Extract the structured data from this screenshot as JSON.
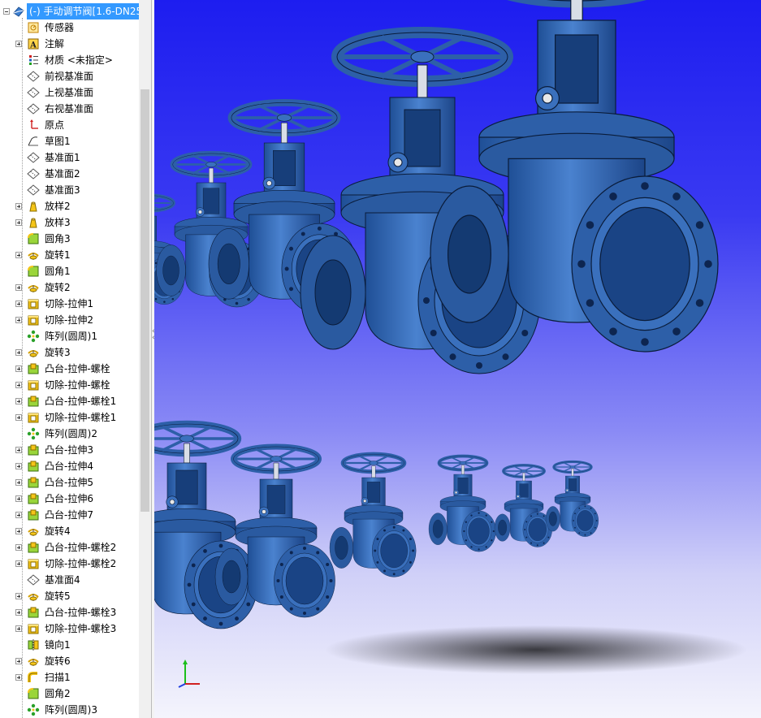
{
  "feature_tree": {
    "root_label": "(-) 手动调节阀[1.6-DN25",
    "items": [
      {
        "label": "传感器",
        "icon": "sensor-icon",
        "expandable": false
      },
      {
        "label": "注解",
        "icon": "annotation-icon",
        "expandable": true
      },
      {
        "label": "材质 <未指定>",
        "icon": "material-icon",
        "expandable": false
      },
      {
        "label": "前视基准面",
        "icon": "plane-icon",
        "expandable": false
      },
      {
        "label": "上视基准面",
        "icon": "plane-icon",
        "expandable": false
      },
      {
        "label": "右视基准面",
        "icon": "plane-icon",
        "expandable": false
      },
      {
        "label": "原点",
        "icon": "origin-icon",
        "expandable": false
      },
      {
        "label": "草图1",
        "icon": "sketch-icon",
        "expandable": false
      },
      {
        "label": "基准面1",
        "icon": "plane-icon",
        "expandable": false
      },
      {
        "label": "基准面2",
        "icon": "plane-icon",
        "expandable": false
      },
      {
        "label": "基准面3",
        "icon": "plane-icon",
        "expandable": false
      },
      {
        "label": "放样2",
        "icon": "loft-icon",
        "expandable": true
      },
      {
        "label": "放样3",
        "icon": "loft-icon",
        "expandable": true
      },
      {
        "label": "圆角3",
        "icon": "fillet-icon",
        "expandable": false
      },
      {
        "label": "旋转1",
        "icon": "revolve-icon",
        "expandable": true
      },
      {
        "label": "圆角1",
        "icon": "fillet-icon",
        "expandable": false
      },
      {
        "label": "旋转2",
        "icon": "revolve-icon",
        "expandable": true
      },
      {
        "label": "切除-拉伸1",
        "icon": "cut-extrude-icon",
        "expandable": true
      },
      {
        "label": "切除-拉伸2",
        "icon": "cut-extrude-icon",
        "expandable": true
      },
      {
        "label": "阵列(圆周)1",
        "icon": "circular-pattern-icon",
        "expandable": false
      },
      {
        "label": "旋转3",
        "icon": "revolve-icon",
        "expandable": true
      },
      {
        "label": "凸台-拉伸-螺栓",
        "icon": "boss-extrude-icon",
        "expandable": true
      },
      {
        "label": "切除-拉伸-螺栓",
        "icon": "cut-extrude-icon",
        "expandable": true
      },
      {
        "label": "凸台-拉伸-螺栓1",
        "icon": "boss-extrude-icon",
        "expandable": true
      },
      {
        "label": "切除-拉伸-螺栓1",
        "icon": "cut-extrude-icon",
        "expandable": true
      },
      {
        "label": "阵列(圆周)2",
        "icon": "circular-pattern-icon",
        "expandable": false
      },
      {
        "label": "凸台-拉伸3",
        "icon": "boss-extrude-icon",
        "expandable": true
      },
      {
        "label": "凸台-拉伸4",
        "icon": "boss-extrude-icon",
        "expandable": true
      },
      {
        "label": "凸台-拉伸5",
        "icon": "boss-extrude-icon",
        "expandable": true
      },
      {
        "label": "凸台-拉伸6",
        "icon": "boss-extrude-icon",
        "expandable": true
      },
      {
        "label": "凸台-拉伸7",
        "icon": "boss-extrude-icon",
        "expandable": true
      },
      {
        "label": "旋转4",
        "icon": "revolve-icon",
        "expandable": true
      },
      {
        "label": "凸台-拉伸-螺栓2",
        "icon": "boss-extrude-icon",
        "expandable": true
      },
      {
        "label": "切除-拉伸-螺栓2",
        "icon": "cut-extrude-icon",
        "expandable": true
      },
      {
        "label": "基准面4",
        "icon": "plane-icon",
        "expandable": false
      },
      {
        "label": "旋转5",
        "icon": "revolve-icon",
        "expandable": true
      },
      {
        "label": "凸台-拉伸-螺栓3",
        "icon": "boss-extrude-icon",
        "expandable": true
      },
      {
        "label": "切除-拉伸-螺栓3",
        "icon": "cut-extrude-icon",
        "expandable": true
      },
      {
        "label": "镜向1",
        "icon": "mirror-icon",
        "expandable": false
      },
      {
        "label": "旋转6",
        "icon": "revolve-icon",
        "expandable": true
      },
      {
        "label": "扫描1",
        "icon": "sweep-icon",
        "expandable": true
      },
      {
        "label": "圆角2",
        "icon": "fillet-icon",
        "expandable": false
      },
      {
        "label": "阵列(圆周)3",
        "icon": "circular-pattern-icon",
        "expandable": false
      }
    ]
  },
  "viewport": {
    "description_icon": "gate-valve-model",
    "colors": {
      "model": "#2e66b4",
      "background_top": "#1d1df0",
      "background_bottom": "#f4f4fc"
    }
  }
}
